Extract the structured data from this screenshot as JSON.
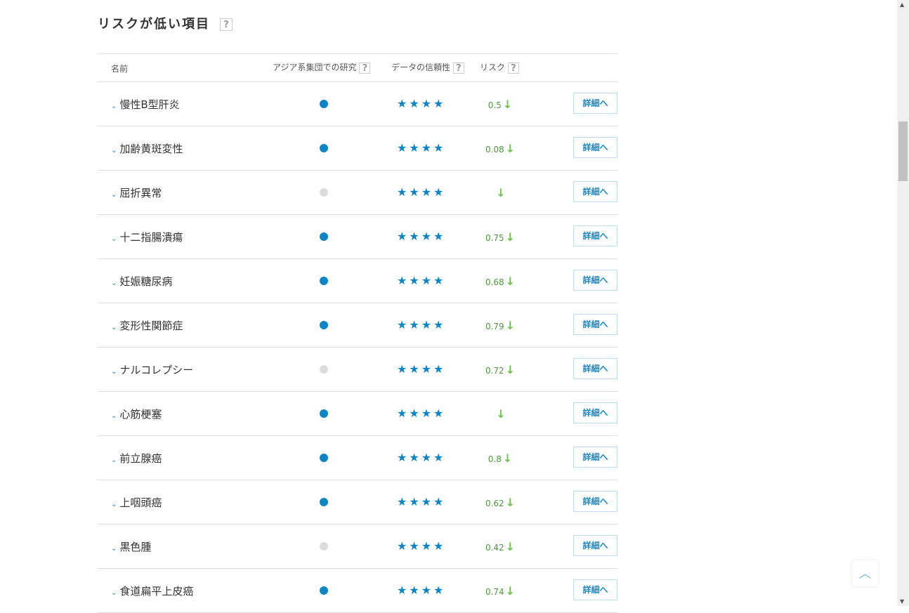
{
  "section": {
    "title": "リスクが低い項目",
    "help": "?"
  },
  "headers": {
    "name": "名前",
    "asian": "アジア系集団での研究",
    "reliability": "データの信頼性",
    "risk": "リスク",
    "help": "?"
  },
  "detail_label": "詳細へ",
  "stars": "★★★★",
  "colors": {
    "dot_on": "#0a86c8",
    "dot_off": "#dcdcdc"
  },
  "rows": [
    {
      "name": "慢性B型肝炎",
      "asian": true,
      "risk": "0.5"
    },
    {
      "name": "加齢黄斑変性",
      "asian": true,
      "risk": "0.08"
    },
    {
      "name": "屈折異常",
      "asian": false,
      "risk": ""
    },
    {
      "name": "十二指腸潰瘍",
      "asian": true,
      "risk": "0.75"
    },
    {
      "name": "妊娠糖尿病",
      "asian": true,
      "risk": "0.68"
    },
    {
      "name": "変形性関節症",
      "asian": true,
      "risk": "0.79"
    },
    {
      "name": "ナルコレプシー",
      "asian": false,
      "risk": "0.72"
    },
    {
      "name": "心筋梗塞",
      "asian": true,
      "risk": ""
    },
    {
      "name": "前立腺癌",
      "asian": true,
      "risk": "0.8"
    },
    {
      "name": "上咽頭癌",
      "asian": true,
      "risk": "0.62"
    },
    {
      "name": "黒色腫",
      "asian": false,
      "risk": "0.42"
    },
    {
      "name": "食道扁平上皮癌",
      "asian": true,
      "risk": "0.74"
    }
  ]
}
